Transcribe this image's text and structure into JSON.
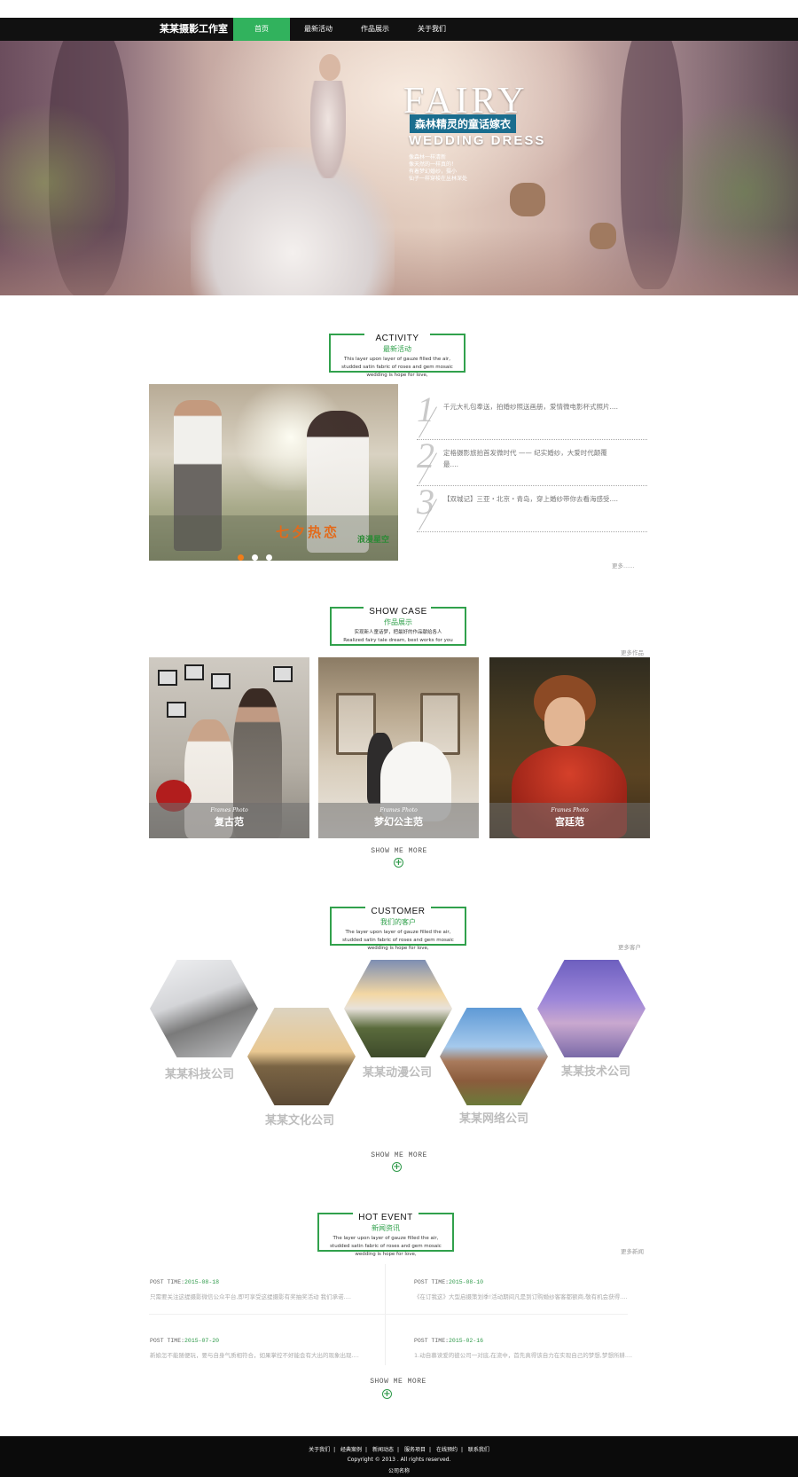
{
  "nav": {
    "brand": "某某摄影工作室",
    "items": [
      {
        "label": "首页",
        "active": true
      },
      {
        "label": "最新活动",
        "active": false
      },
      {
        "label": "作品展示",
        "active": false
      },
      {
        "label": "关于我们",
        "active": false
      }
    ],
    "accent_color": "#31b25d"
  },
  "hero": {
    "title": "FAIRY",
    "subtitle": "森林精灵的童话嫁衣",
    "tagline": "WEDDING DRESS",
    "lines": [
      "像森林一样清新",
      "像天然的一样真的！",
      "有着梦幻婚纱，摄小",
      "仙子一样穿梭在丛林深处"
    ]
  },
  "activity": {
    "title_en": "ACTIVITY",
    "title_cn": "最新活动",
    "desc": "This layer upon layer of gauze filled the air, studded satin fabric of roses and gem mosaic wedding is hope for love,",
    "banner_text": "七夕热恋",
    "banner_sub": "浪漫星空",
    "items": [
      {
        "num": "1",
        "text": "千元大礼包奉送，拍婚纱照送画册，爱情微电影杯式照片...."
      },
      {
        "num": "2",
        "text": "定格摄影旅拍首发微时代 —— 纪实婚纱，大爱时代颠覆最...."
      },
      {
        "num": "3",
        "text": "【双城记】三亚・北京・青岛，穿上婚纱带你去看海感受...."
      }
    ],
    "more": "更多......"
  },
  "showcase": {
    "title_en": "SHOW CASE",
    "title_cn": "作品展示",
    "desc_cn": "实现新人童话梦，把最好的作品献给各人",
    "desc_en": "Realized fairy tale dream, best works for you",
    "more": "更多作品",
    "cases": [
      {
        "frames": "Frames  Photo",
        "name": "复古范"
      },
      {
        "frames": "Frames  Photo",
        "name": "梦幻公主范"
      },
      {
        "frames": "Frames  Photo",
        "name": "宫廷范"
      }
    ],
    "show_more": "SHOW ME MORE"
  },
  "customer": {
    "title_en": "CUSTOMER",
    "title_cn": "我们的客户",
    "desc": "The layer upon layer of gauze filled the air, studded satin fabric of roses and gem mosaic wedding is hope for love,",
    "more": "更多客户",
    "clients": [
      {
        "name": "某某科技公司",
        "image": "eiffel-tower-gray"
      },
      {
        "name": "某某文化公司",
        "image": "eiffel-tower-sunset"
      },
      {
        "name": "某某动漫公司",
        "image": "mountain-sunrise"
      },
      {
        "name": "某某网络公司",
        "image": "mansion-blue-sky"
      },
      {
        "name": "某某技术公司",
        "image": "burj-khalifa-dusk"
      }
    ],
    "show_more": "SHOW ME MORE"
  },
  "hot_event": {
    "title_en": "HOT  EVENT",
    "title_cn": "新闻资讯",
    "desc": "The layer upon layer of gauze filled the air, studded satin fabric of roses and gem mosaic wedding is hope for love,",
    "more": "更多新闻",
    "news": [
      {
        "label": "POST TIME:",
        "date": "2015-08-18",
        "summary": "只需要关注这缇摄影微信公众平台,即可享受这缇摄影有奖抽奖活动 我们承诺...."
      },
      {
        "label": "POST TIME:",
        "date": "2015-08-10",
        "summary": "《在订我这》大型启摄策划季!活动期间凡是到订购婚纱客客都额商,敬有机会获得...."
      },
      {
        "label": "POST TIME:",
        "date": "2015-07-20",
        "summary": "新娘怎不能随便玩，要与自身气质相符合，如果掌控不好能会有大出的现象出现...."
      },
      {
        "label": "POST TIME:",
        "date": "2015-02-16",
        "summary": "1.动自慕读爱的彼公司一对底,在流中，首先真得该自力在实现自己的梦想,梦想所耕...."
      }
    ],
    "show_more": "SHOW ME MORE"
  },
  "footer": {
    "links": [
      "关于我们",
      "经典案例",
      "新闻动态",
      "服务项目",
      "在线预约",
      "联系我们"
    ],
    "separator": "|",
    "copyright": "Copyright © 2013 . All rights reserved.",
    "company": "公司名称"
  }
}
